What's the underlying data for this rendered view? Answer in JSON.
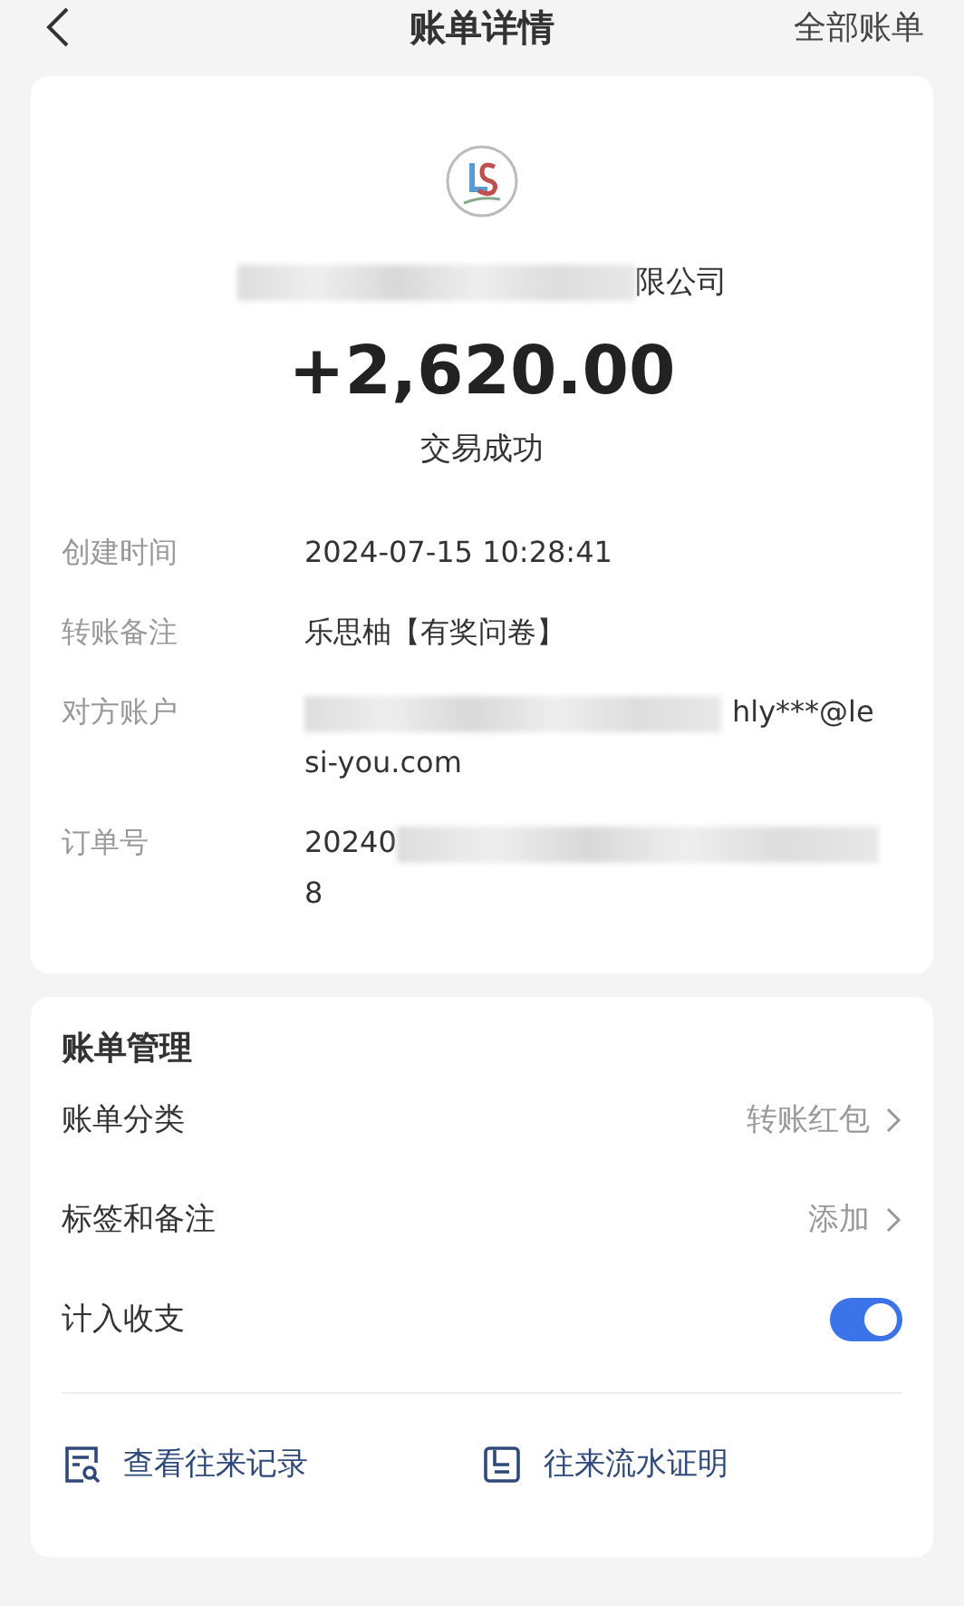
{
  "header": {
    "title": "账单详情",
    "action": "全部账单"
  },
  "summary": {
    "payee_visible": "限公司",
    "amount": "+2,620.00",
    "status": "交易成功"
  },
  "details": [
    {
      "kind": "plain",
      "label": "创建时间",
      "value": "2024-07-15 10:28:41"
    },
    {
      "kind": "plain",
      "label": "转账备注",
      "value": "乐思柚【有奖问卷】"
    },
    {
      "kind": "blur_before",
      "label": "对方账户",
      "value": "hly***@le",
      "value_end": "si-you.com"
    },
    {
      "kind": "blur_middle",
      "label": "订单号",
      "value": "20240",
      "value_end": "8"
    }
  ],
  "management": {
    "title": "账单管理",
    "rows": [
      {
        "kind": "link",
        "label": "账单分类",
        "value": "转账红包"
      },
      {
        "kind": "link",
        "label": "标签和备注",
        "value": "添加"
      },
      {
        "kind": "toggle",
        "label": "计入收支",
        "on": true
      }
    ]
  },
  "actions": [
    {
      "label": "查看往来记录"
    },
    {
      "label": "往来流水证明"
    }
  ]
}
